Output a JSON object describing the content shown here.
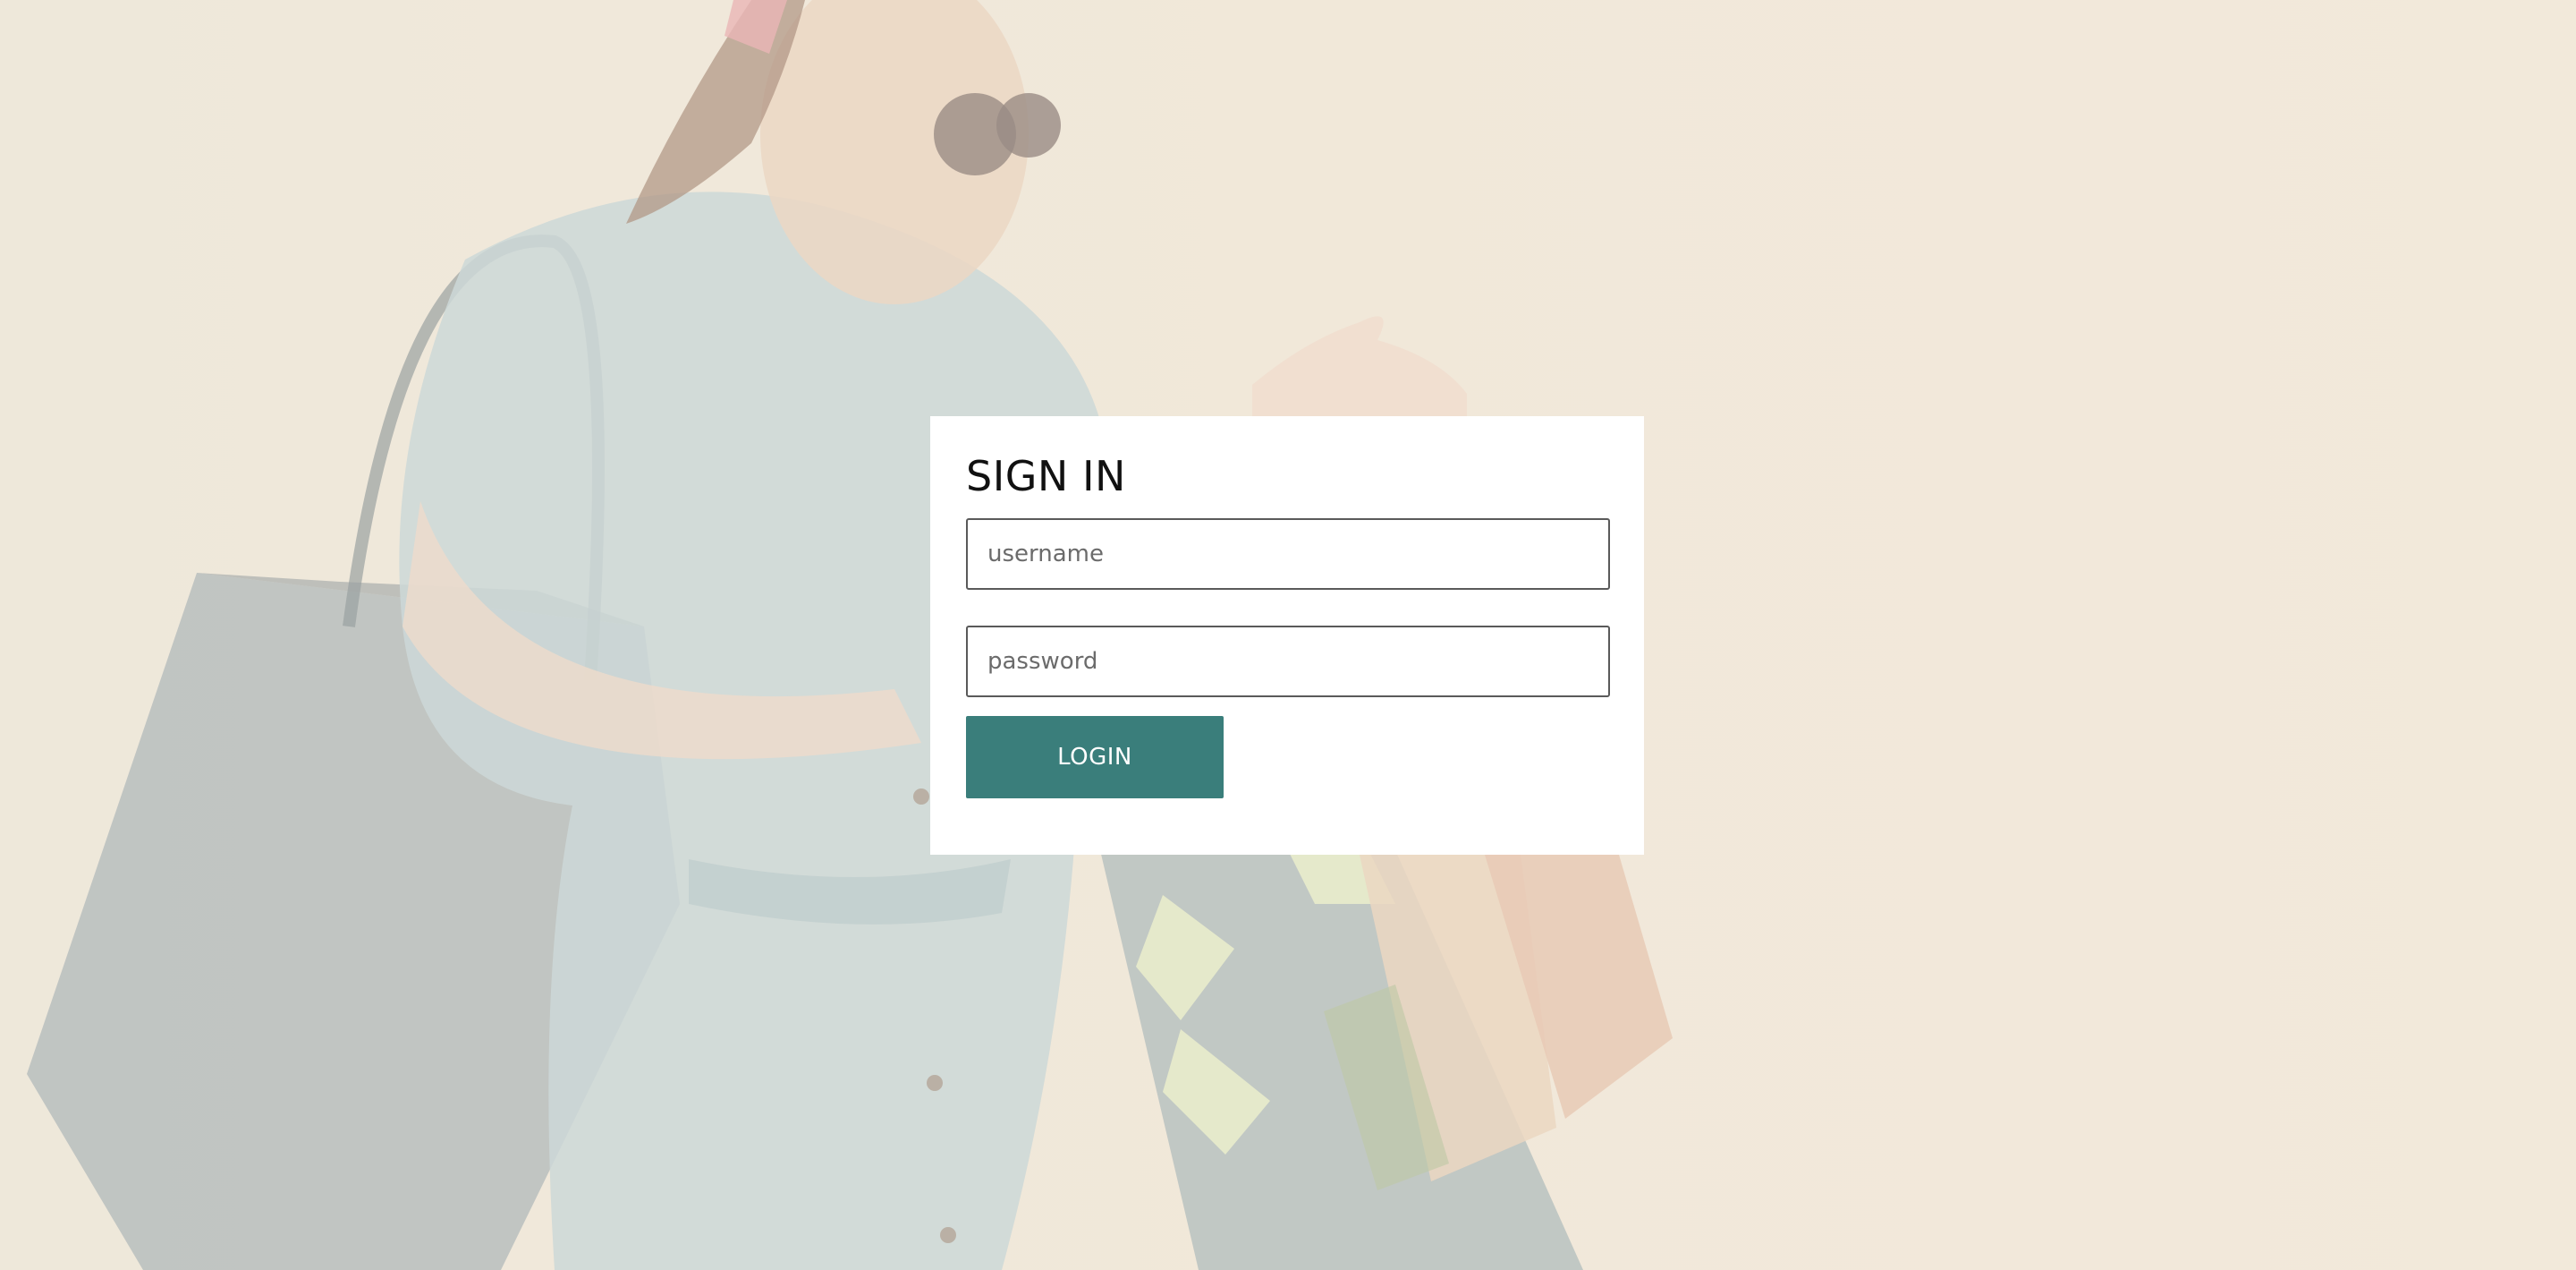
{
  "login": {
    "title": "SIGN IN",
    "username_placeholder": "username",
    "password_placeholder": "password",
    "button_label": "LOGIN"
  },
  "colors": {
    "background": "#efe6d6",
    "card": "#ffffff",
    "button": "#3a7e7b",
    "button_text": "#ffffff"
  },
  "background_image": "woman-with-shopping-bags-photo"
}
